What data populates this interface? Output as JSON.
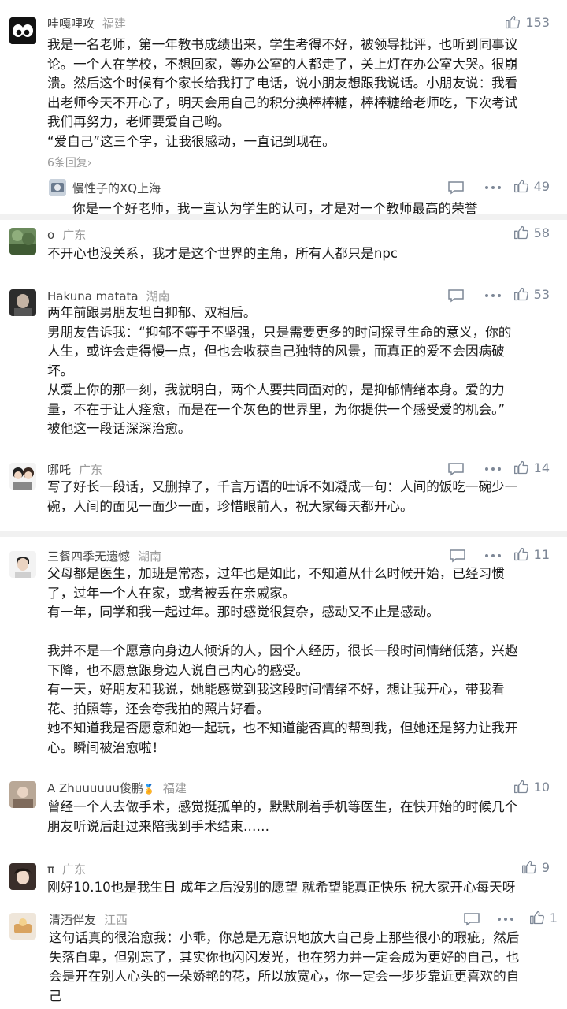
{
  "comments": [
    {
      "user": "哇嘎哩攻",
      "location": "福建",
      "likes": "153",
      "text": "我是一名老师，第一年教书成绩出来，学生考得不好，被领导批评，也听到同事议\n论。一个人在学校，不想回家，等办公室的人都走了，关上灯在办公室大哭。很崩\n溃。然后这个时候有个家长给我打了电话，说小朋友想跟我说话。小朋友说：我看\n出老师今天不开心了，明天会用自己的积分换棒棒糖，棒棒糖给老师吃，下次考试\n我们再努力，老师要爱自己哟。\n“爱自己”这三个字，让我很感动，一直记到现在。",
      "replies_link": "6条回复",
      "reply": {
        "user": "慢性子的XQ",
        "location": "上海",
        "likes": "49",
        "text": "你是一个好老师，我一直认为学生的认可，才是对一个教师最高的荣誉"
      }
    },
    {
      "user": "o",
      "location": "广东",
      "likes": "58",
      "text": "不开心也没关系，我才是这个世界的主角，所有人都只是npc"
    },
    {
      "user": "Hakuna matata",
      "location": "湖南",
      "likes": "53",
      "text": "两年前跟男朋友坦白抑郁、双相后。\n男朋友告诉我：“抑郁不等于不坚强，只是需要更多的时间探寻生命的意义，你的\n人生，或许会走得慢一点，但也会收获自己独特的风景，而真正的爱不会因病破\n坏。\n从爱上你的那一刻，我就明白，两个人要共同面对的，是抑郁情绪本身。爱的力\n量，不在于让人痊愈，而是在一个灰色的世界里，为你提供一个感受爱的机会。”\n被他这一段话深深治愈。"
    },
    {
      "user": "哪吒",
      "location": "广东",
      "likes": "14",
      "text": "写了好长一段话，又删掉了，千言万语的吐诉不如凝成一句：人间的饭吃一碗少一\n碗，人间的面见一面少一面，珍惜眼前人，祝大家每天都开心。"
    },
    {
      "user": "三餐四季无遗憾",
      "location": "湖南",
      "likes": "11",
      "text": "父母都是医生，加班是常态，过年也是如此，不知道从什么时候开始，已经习惯\n了，过年一个人在家，或者被丢在亲戚家。\n有一年，同学和我一起过年。那时感觉很复杂，感动又不止是感动。\n\n我并不是一个愿意向身边人倾诉的人，因个人经历，很长一段时间情绪低落，兴趣\n下降，也不愿意跟身边人说自己内心的感受。\n有一天，好朋友和我说，她能感觉到我这段时间情绪不好，想让我开心，带我看\n花、拍照等，还会夸我拍的照片好看。\n她不知道我是否愿意和她一起玩，也不知道能否真的帮到我，但她还是努力让我开\n心。瞬间被治愈啦！"
    },
    {
      "user": "A Zhuuuuuu俊鹏",
      "location": "福建",
      "likes": "10",
      "text": "曾经一个人去做手术，感觉挺孤单的，默默刷着手机等医生，在快开始的时候几个\n朋友听说后赶过来陪我到手术结束……"
    },
    {
      "user": "π",
      "location": "广东",
      "likes": "9",
      "text": "刚好10.10也是我生日 成年之后没别的愿望 就希望能真正快乐 祝大家开心每天呀"
    },
    {
      "user": "清酒伴友",
      "location": "江西",
      "likes": "1",
      "text": "这句话真的很治愈我：小乖，你总是无意识地放大自己身上那些很小的瑕疵，然后\n失落自卑，但别忘了，其实你也闪闪发光，也在努力并一定会成为更好的自己，也\n会是开在别人心头的一朵娇艳的花，所以放宽心，你一定会一步步靠近更喜欢的自\n己"
    }
  ],
  "icons": {
    "like": "thumbs-up-icon",
    "reply": "comment-bubble-icon",
    "more": "more-dots-icon"
  },
  "colors": {
    "text": "#1c1c1c",
    "meta": "#9a9a9a",
    "icon": "#7d8796",
    "divider": "#f1f1f1"
  }
}
